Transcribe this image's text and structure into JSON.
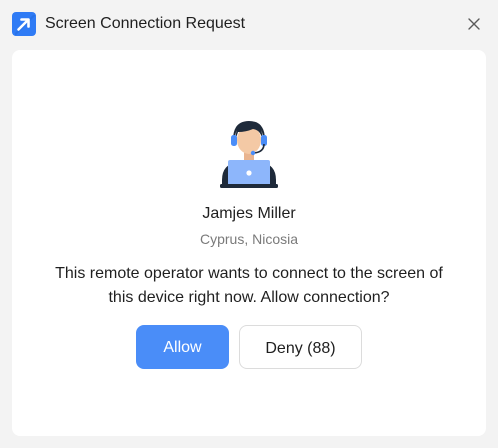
{
  "window": {
    "title": "Screen Connection Request",
    "app_icon": "arrow-up-right-icon",
    "close_icon": "close-icon"
  },
  "operator": {
    "avatar_icon": "support-operator-icon",
    "name": "Jamjes Miller",
    "location": "Cyprus, Nicosia"
  },
  "message": "This remote operator wants to connect to the screen of this device right now. Allow connection?",
  "buttons": {
    "allow_label": "Allow",
    "deny_label": "Deny (88)"
  },
  "colors": {
    "accent": "#4a8df8",
    "background": "#f3f3f3",
    "card": "#ffffff",
    "secondary_text": "#7a7a7a"
  }
}
